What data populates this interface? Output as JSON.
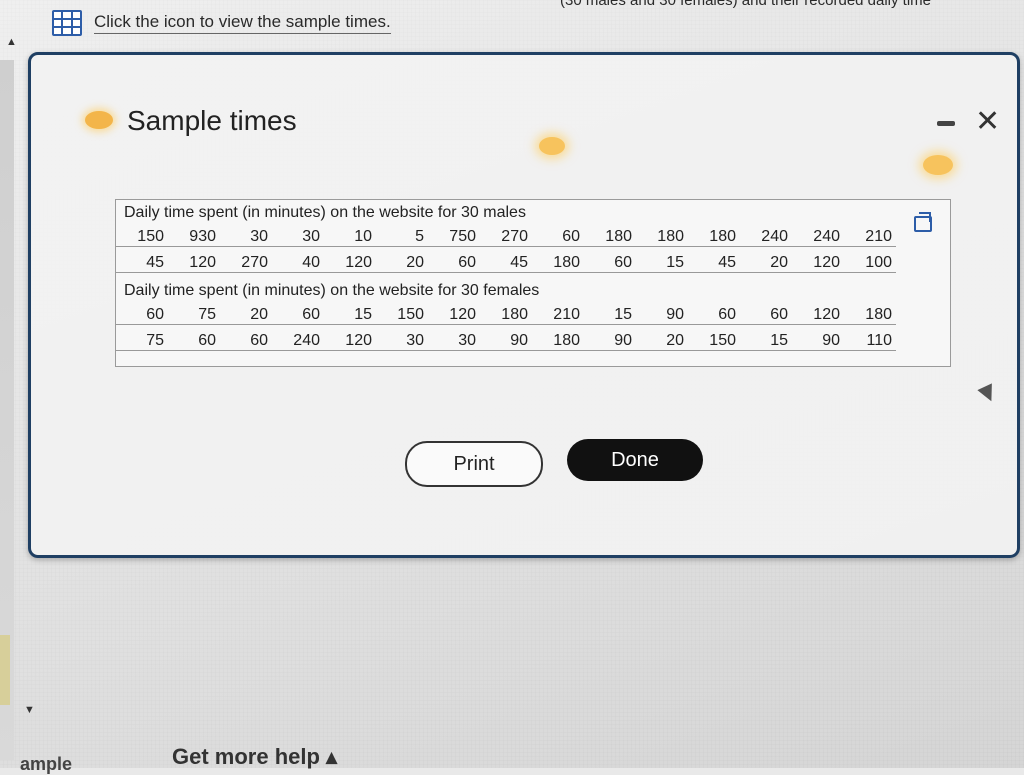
{
  "top_banner": "(30 males and 30 females) and their recorded daily time",
  "instruction": {
    "text": "Click the icon to view the sample times."
  },
  "dialog": {
    "title": "Sample times",
    "males_label": "Daily time spent (in minutes) on the website for 30 males",
    "males_row1": [
      "150",
      "930",
      "30",
      "30",
      "10",
      "5",
      "750",
      "270",
      "60",
      "180",
      "180",
      "180",
      "240",
      "240",
      "210"
    ],
    "males_row2": [
      "45",
      "120",
      "270",
      "40",
      "120",
      "20",
      "60",
      "45",
      "180",
      "60",
      "15",
      "45",
      "20",
      "120",
      "100"
    ],
    "females_label": "Daily time spent (in minutes) on the website for 30 females",
    "females_row1": [
      "60",
      "75",
      "20",
      "60",
      "15",
      "150",
      "120",
      "180",
      "210",
      "15",
      "90",
      "60",
      "60",
      "120",
      "180"
    ],
    "females_row2": [
      "75",
      "60",
      "60",
      "240",
      "120",
      "30",
      "30",
      "90",
      "180",
      "90",
      "20",
      "150",
      "15",
      "90",
      "110"
    ],
    "print_label": "Print",
    "done_label": "Done"
  },
  "footer": {
    "help_label": "Get more help ▴",
    "crumb": "ample"
  },
  "icons": {
    "grid": "grid-icon",
    "copy": "copy-icon",
    "minimize": "minimize-icon",
    "close": "close-icon"
  }
}
